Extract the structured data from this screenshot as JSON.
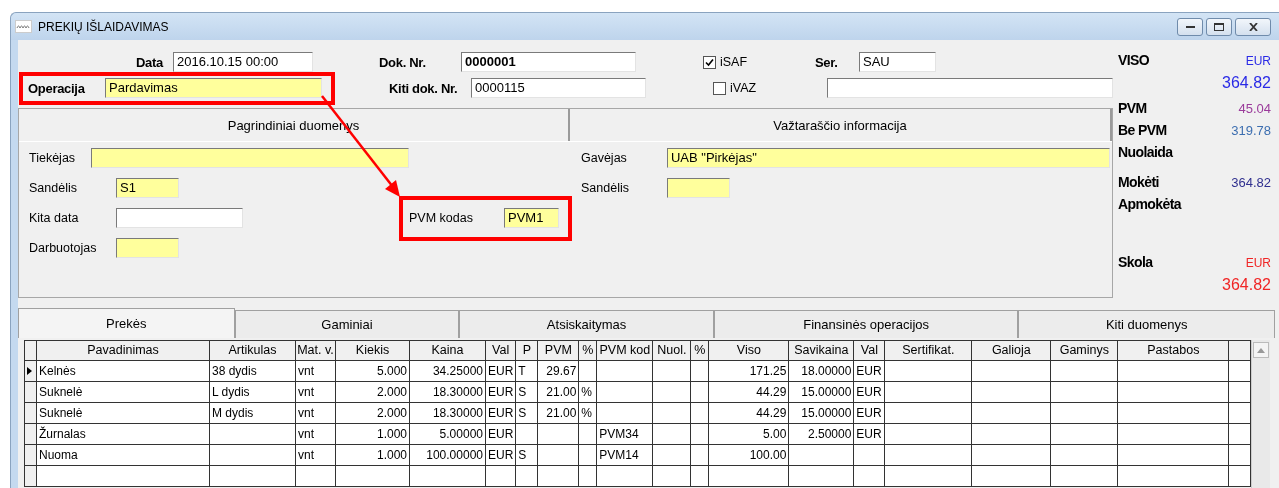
{
  "window": {
    "title": "PREKIŲ  IŠLAIDAVIMAS"
  },
  "header": {
    "date": {
      "label": "Data",
      "value": "2016.10.15 00:00"
    },
    "operation": {
      "label": "Operacija",
      "value": "Pardavimas",
      "required": true
    },
    "doc_no": {
      "label": "Dok. Nr.",
      "value": "0000001"
    },
    "other_doc_no": {
      "label": "Kiti dok. Nr.",
      "value": "0000115"
    },
    "checkboxes": [
      {
        "label": "iSAF",
        "checked": true
      },
      {
        "label": "iVAZ",
        "checked": false
      }
    ],
    "series": {
      "label": "Ser.",
      "value": "SAU"
    }
  },
  "sections": [
    {
      "title": "Pagrindiniai duomenys",
      "fields": [
        {
          "label": "Tiekėjas",
          "required": true
        },
        {
          "label": "Sandėlis",
          "value": "S1",
          "required": true
        },
        {
          "label": "Kita data",
          "required": false
        },
        {
          "label": "Darbuotojas",
          "required": true
        }
      ],
      "vat_code": {
        "label": "PVM kodas",
        "value": "PVM1",
        "required": true
      }
    },
    {
      "title": "Važtaraščio informacija",
      "fields": [
        {
          "label": "Gavėjas",
          "value": "UAB \"Pirkėjas\"",
          "required": true
        },
        {
          "label": "Sandėlis",
          "required": true
        }
      ]
    }
  ],
  "summary": [
    {
      "kind": "total",
      "label": "VISO",
      "currency": "EUR",
      "amount": "364.82",
      "color": "#2a2ae6"
    },
    {
      "kind": "line",
      "label": "PVM",
      "amount": "45.04",
      "color": "#9b3b9b"
    },
    {
      "kind": "line",
      "label": "Be PVM",
      "amount": "319.78",
      "color": "#3c6eb0"
    },
    {
      "kind": "line",
      "label": "Nuolaida"
    },
    {
      "kind": "line",
      "label": "Mokėti",
      "amount": "364.82",
      "color": "#30308f"
    },
    {
      "kind": "line",
      "label": "Apmokėta"
    },
    {
      "kind": "total",
      "label": "Skola",
      "currency": "EUR",
      "amount": "364.82",
      "color": "#f02525"
    }
  ],
  "tabs": [
    {
      "label": "Prekės",
      "selected": true
    },
    {
      "label": "Gaminiai",
      "selected": false
    },
    {
      "label": "Atsiskaitymas",
      "selected": false
    },
    {
      "label": "Finansinės operacijos",
      "selected": false
    },
    {
      "label": "Kiti duomenys",
      "selected": false
    }
  ],
  "table": {
    "columns": [
      {
        "label": "Pavadinimas"
      },
      {
        "label": "Artikulas"
      },
      {
        "label": "Mat. v."
      },
      {
        "label": "Kiekis",
        "kind": "number"
      },
      {
        "label": "Kaina",
        "kind": "number"
      },
      {
        "label": "Val"
      },
      {
        "label": "P"
      },
      {
        "label": "PVM",
        "kind": "number"
      },
      {
        "label": "%"
      },
      {
        "label": "PVM kod"
      },
      {
        "label": "Nuol."
      },
      {
        "label": "%"
      },
      {
        "label": "Viso",
        "kind": "number"
      },
      {
        "label": "Savikaina",
        "kind": "number"
      },
      {
        "label": "Val"
      },
      {
        "label": "Sertifikat."
      },
      {
        "label": "Galioja"
      },
      {
        "label": "Gaminys"
      },
      {
        "label": "Pastabos"
      }
    ],
    "rows": [
      {
        "selected": true,
        "cells": [
          "Kelnės",
          "38 dydis",
          "vnt",
          "5.000",
          "34.25000",
          "EUR",
          "T",
          "29.67",
          null,
          null,
          null,
          null,
          "171.25",
          "18.00000",
          "EUR",
          null,
          null,
          null,
          null
        ]
      },
      {
        "selected": false,
        "cells": [
          "Suknelė",
          "L dydis",
          "vnt",
          "2.000",
          "18.30000",
          "EUR",
          "S",
          "21.00",
          "%",
          null,
          null,
          null,
          "44.29",
          "15.00000",
          "EUR",
          null,
          null,
          null,
          null
        ]
      },
      {
        "selected": false,
        "cells": [
          "Suknelė",
          "M dydis",
          "vnt",
          "2.000",
          "18.30000",
          "EUR",
          "S",
          "21.00",
          "%",
          null,
          null,
          null,
          "44.29",
          "15.00000",
          "EUR",
          null,
          null,
          null,
          null
        ]
      },
      {
        "selected": false,
        "cells": [
          "Žurnalas",
          null,
          "vnt",
          "1.000",
          "5.00000",
          "EUR",
          null,
          null,
          null,
          "PVM34",
          null,
          null,
          "5.00",
          "2.50000",
          "EUR",
          null,
          null,
          null,
          null
        ]
      },
      {
        "selected": false,
        "cells": [
          "Nuoma",
          null,
          "vnt",
          "1.000",
          "100.00000",
          "EUR",
          "S",
          null,
          null,
          "PVM14",
          null,
          null,
          "100.00",
          null,
          null,
          null,
          null,
          null,
          null
        ]
      }
    ]
  }
}
